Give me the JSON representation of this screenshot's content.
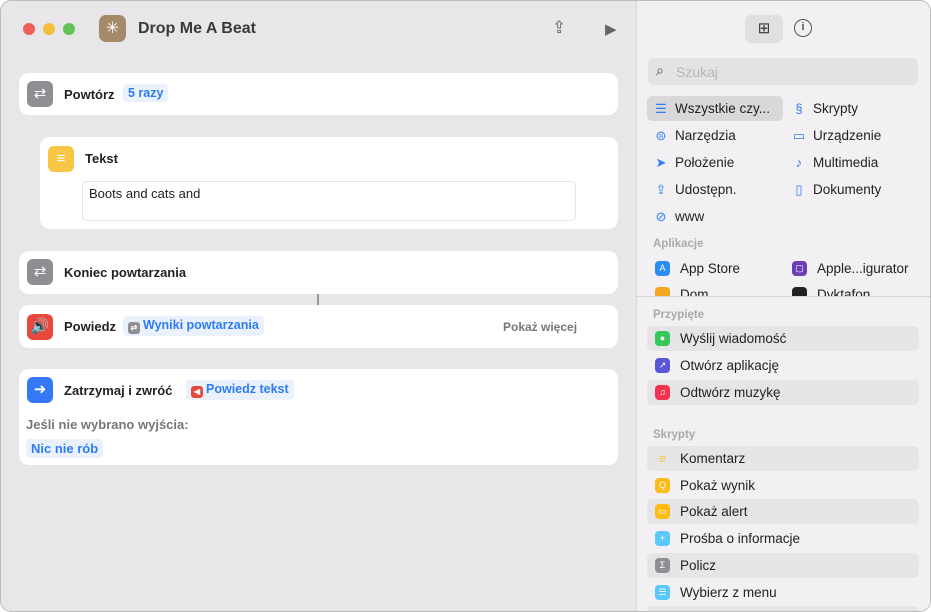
{
  "window": {
    "title": "Drop Me A Beat"
  },
  "actions": {
    "repeat": {
      "label": "Powtórz",
      "count": "5 razy"
    },
    "text": {
      "label": "Tekst",
      "value": "Boots and cats and"
    },
    "end_repeat": {
      "label": "Koniec powtarzania"
    },
    "speak": {
      "label": "Powiedz",
      "token": "Wyniki powtarzania",
      "show_more": "Pokaż więcej"
    },
    "stop": {
      "label": "Zatrzymaj i zwróć",
      "token": "Powiedz tekst",
      "no_output_label": "Jeśli nie wybrano wyjścia:",
      "no_output_value": "Nic nie rób"
    }
  },
  "sidebar": {
    "search_placeholder": "Szukaj",
    "categories": [
      {
        "label": "Wszystkie czy...",
        "icon": "list-icon"
      },
      {
        "label": "Skrypty",
        "icon": "scripts-icon"
      },
      {
        "label": "Narzędzia",
        "icon": "toggles-icon"
      },
      {
        "label": "Urządzenie",
        "icon": "display-icon"
      },
      {
        "label": "Położenie",
        "icon": "location-icon"
      },
      {
        "label": "Multimedia",
        "icon": "music-note-icon"
      },
      {
        "label": "Udostępn.",
        "icon": "share-icon"
      },
      {
        "label": "Dokumenty",
        "icon": "document-icon"
      },
      {
        "label": "www",
        "icon": "compass-icon"
      }
    ],
    "apps_header": "Aplikacje",
    "apps": [
      "App Store",
      "Apple...igurator",
      "Dom",
      "Dyktafon"
    ],
    "pinned_header": "Przypięte",
    "pinned": [
      "Wyślij wiadomość",
      "Otwórz aplikację",
      "Odtwórz muzykę"
    ],
    "scripts_header": "Skrypty",
    "scripts": [
      "Komentarz",
      "Pokaż wynik",
      "Pokaż alert",
      "Prośba o informacje",
      "Policz",
      "Wybierz z menu"
    ]
  }
}
